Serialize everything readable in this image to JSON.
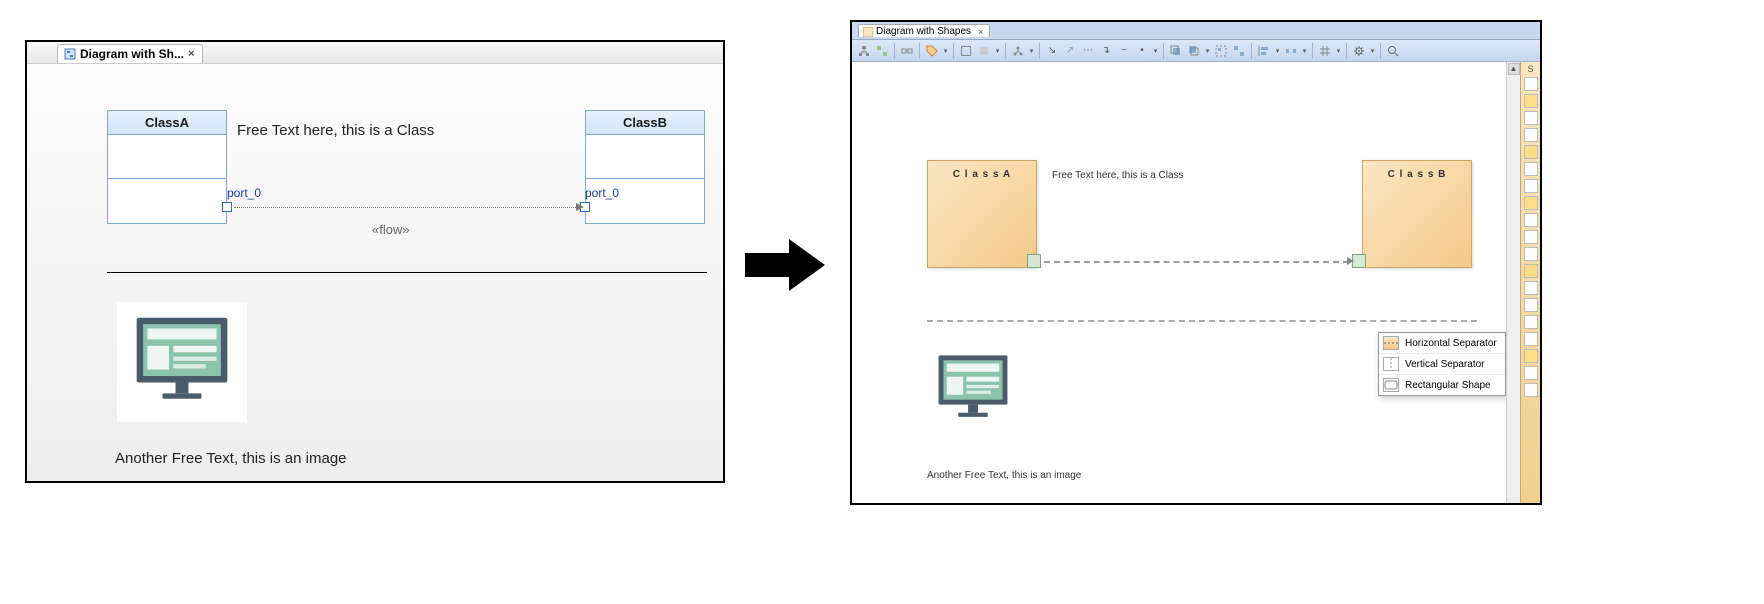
{
  "left": {
    "tab_title": "Diagram with Sh...",
    "classA": {
      "name": "ClassA",
      "port": "port_0"
    },
    "classB": {
      "name": "ClassB",
      "port": "port_0"
    },
    "free_text_1": "Free Text here, this is a Class",
    "flow_label": "«flow»",
    "free_text_2": "Another Free Text, this is an image"
  },
  "right": {
    "tab_title": "Diagram with Shapes",
    "classA": {
      "name": "C l a s s A"
    },
    "classB": {
      "name": "C l a s s B"
    },
    "free_text_1": "Free Text here, this is a Class",
    "free_text_2": "Another Free Text, this is an image",
    "popup": {
      "item1": "Horizontal Separator",
      "item2": "Vertical Separator",
      "item3": "Rectangular Shape"
    },
    "side_tab": "S"
  },
  "icons": {
    "diagram": "diagram-icon",
    "search": "search-icon",
    "gear": "gear-icon"
  }
}
